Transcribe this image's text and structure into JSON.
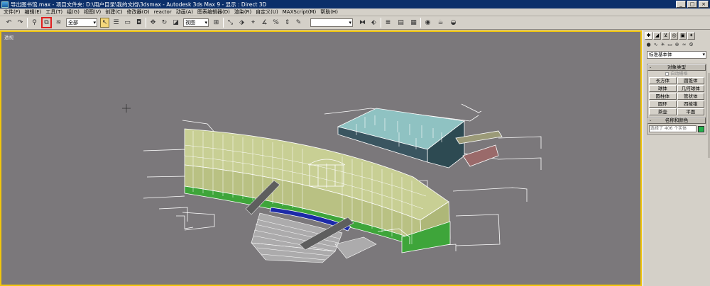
{
  "titlebar": {
    "text": "导出图书馆.max    - 项目文件夹: D:\\用户目录\\我的文档\\3dsmax     - Autodesk 3ds Max 9     - 显示 : Direct 3D"
  },
  "menubar": {
    "items": [
      "文件(F)",
      "编辑(E)",
      "工具(T)",
      "组(G)",
      "视图(V)",
      "创建(C)",
      "修改器(O)",
      "reactor",
      "动画(A)",
      "图表编辑器(D)",
      "渲染(R)",
      "自定义(U)",
      "MAXScript(M)",
      "帮助(H)"
    ]
  },
  "toolbar": {
    "selection_filter": "全部",
    "ref_coord": "视图",
    "named_selection": ""
  },
  "viewport": {
    "label": "透视"
  },
  "command_panel": {
    "category": "标准基本体",
    "object_type": {
      "header": "对象类型",
      "autogrid": "自动栅格",
      "buttons": [
        "长方体",
        "圆锥体",
        "球体",
        "几何球体",
        "圆柱体",
        "管状体",
        "圆环",
        "四棱锥",
        "茶壶",
        "平面"
      ]
    },
    "name_color": {
      "header": "名称和颜色",
      "field": "选择了 406 个实体",
      "color": "#22b14c"
    }
  },
  "colors": {
    "viewport_bg": "#7b787b",
    "viewport_border": "#f2c60a",
    "titlebar": "#0b2f6a",
    "highlight": "#e02020"
  }
}
